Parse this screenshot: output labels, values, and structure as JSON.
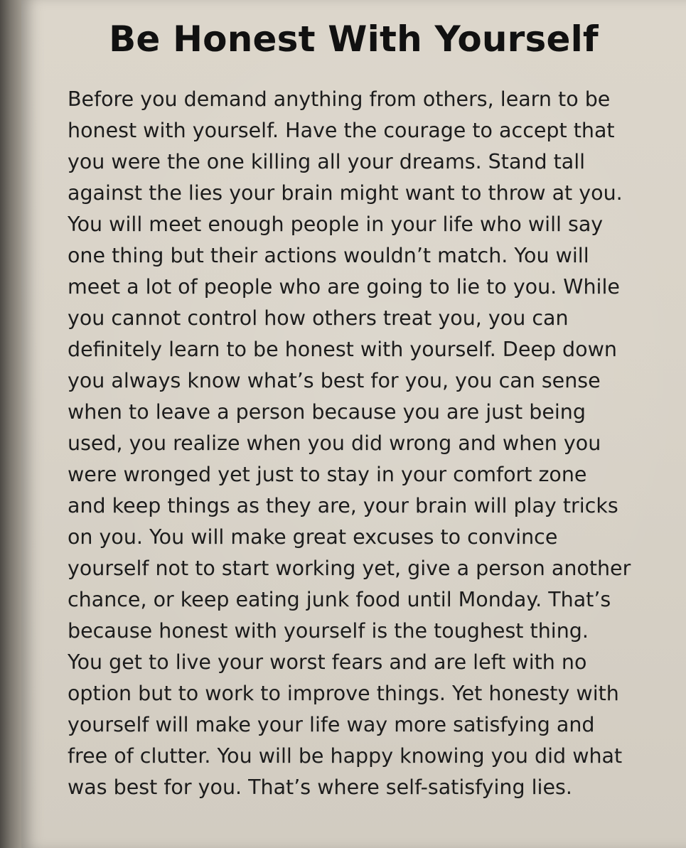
{
  "title": "Be Honest With Yourself",
  "lines": [
    "Before you demand anything from others, learn to be",
    "honest with yourself. Have the courage to accept that",
    "you were the one killing all your dreams. Stand tall",
    "against the lies your brain might want to throw at you.",
    "You will meet enough people in your life who will say",
    "one thing but their actions wouldn’t match. You will",
    "meet a lot of people who are going to lie to you. While",
    "you cannot control how others treat you, you can",
    "definitely learn to be honest with yourself. Deep down",
    "you always know what’s best for you, you can sense",
    "when to leave a person because you are just being",
    "used, you realize when you did wrong and when you",
    "were wronged yet just to stay in your comfort zone",
    "and keep things as they are, your brain will play tricks",
    "on you. You will make great excuses to convince",
    "yourself not to start working yet, give a person another",
    "chance, or keep eating junk food until Monday. That’s",
    "because honest with yourself is the toughest thing.",
    "You get to live your worst fears and are left with no",
    "option but to work to improve things. Yet honesty with",
    "yourself will make your life way more satisfying and",
    "free of clutter. You will be happy knowing you did what",
    "was best for you. That’s where self-satisfying lies."
  ]
}
